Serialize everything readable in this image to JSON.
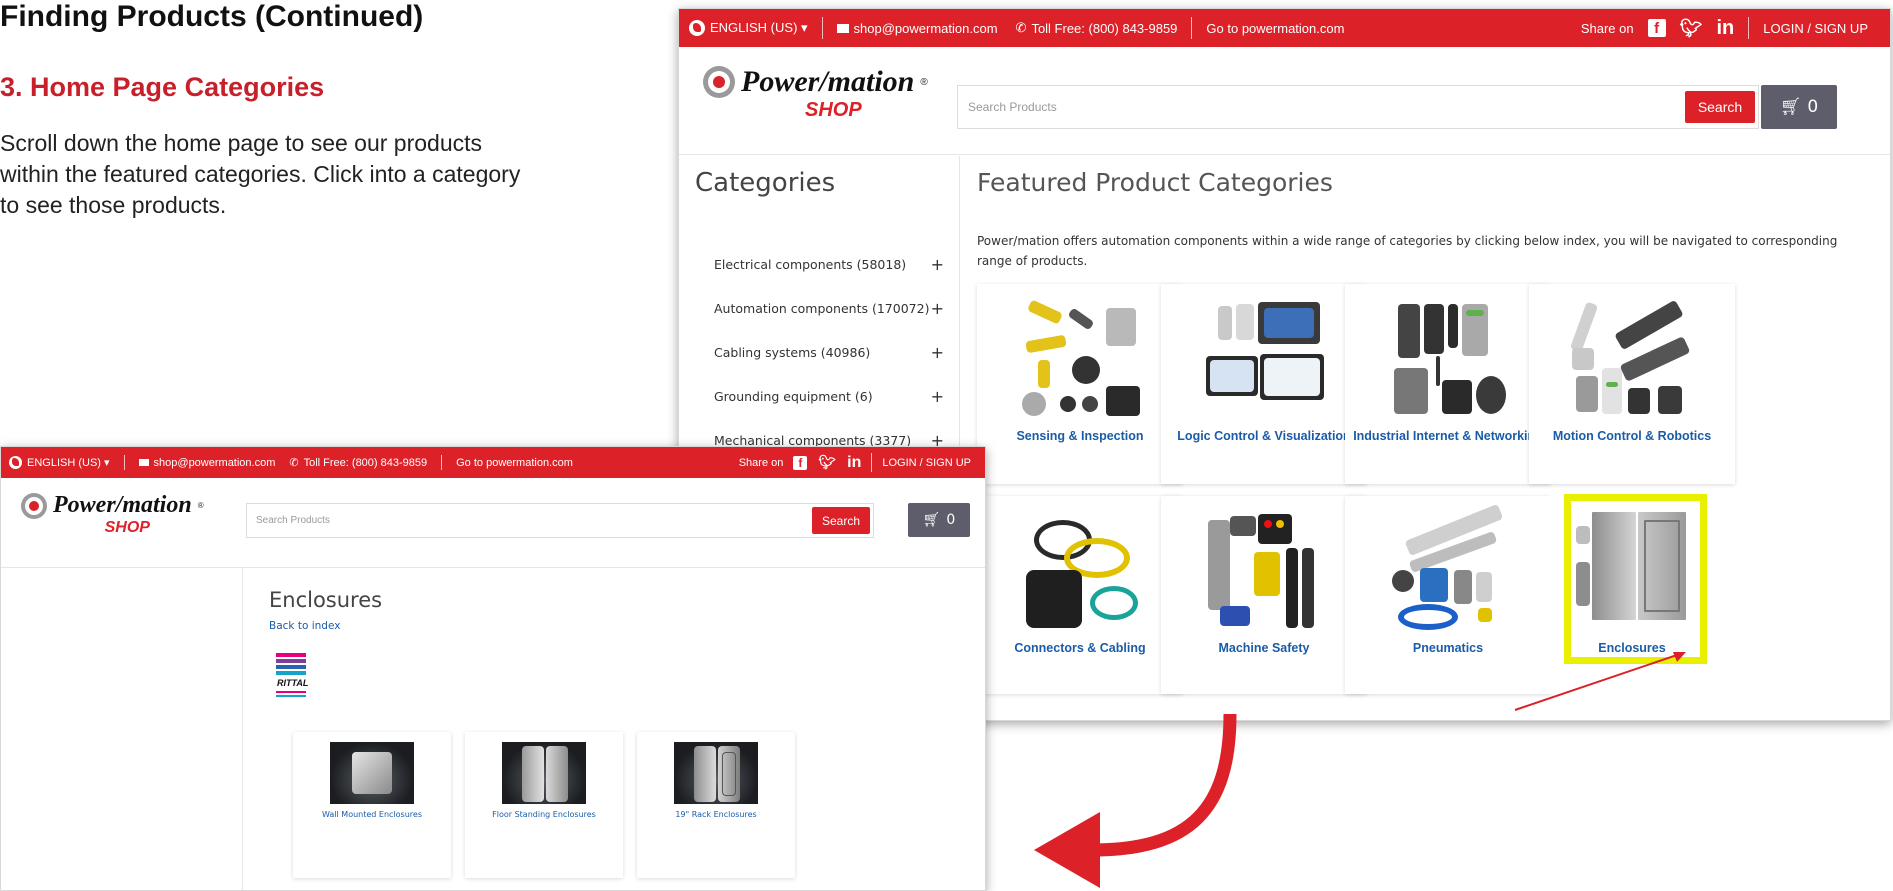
{
  "doc": {
    "heading": "Finding Products (Continued)",
    "subheading": "3.  Home Page Categories",
    "body_lines": [
      "Scroll down the home page to see our products",
      "within the featured categories. Click into a category",
      "to see those products."
    ]
  },
  "topbar": {
    "language": "ENGLISH (US) ▾",
    "email": "shop@powermation.com",
    "toll_free": "Toll Free: (800) 843-9859",
    "goto": "Go to powermation.com",
    "share_on": "Share on",
    "login": "LOGIN / SIGN UP"
  },
  "logo": {
    "word": "Power/mation",
    "reg": "®",
    "shop": "SHOP"
  },
  "search": {
    "placeholder": "Search Products",
    "button": "Search"
  },
  "cart": {
    "icon": "cart-icon",
    "count": "0"
  },
  "sidebar": {
    "title": "Categories",
    "items": [
      {
        "label": "Electrical components (58018)",
        "expand": "+"
      },
      {
        "label": "Automation components (170072)",
        "expand": "+"
      },
      {
        "label": "Cabling systems (40986)",
        "expand": "+"
      },
      {
        "label": "Grounding equipment (6)",
        "expand": "+"
      },
      {
        "label": "Mechanical components (3377)",
        "expand": "+"
      }
    ]
  },
  "featured": {
    "title": "Featured Product Categories",
    "description": "Power/mation offers automation components within a wide range of categories by clicking below index, you will be navigated to corresponding range of products.",
    "categories": [
      {
        "label": "Sensing & Inspection"
      },
      {
        "label": "Logic Control & Visualization"
      },
      {
        "label": "Industrial Internet & Networking"
      },
      {
        "label": "Motion Control & Robotics"
      },
      {
        "label": "Connectors & Cabling"
      },
      {
        "label": "Machine Safety"
      },
      {
        "label": "Pneumatics"
      },
      {
        "label": "Enclosures"
      }
    ],
    "highlight_color": "#e8f000"
  },
  "detail": {
    "title": "Enclosures",
    "back": "Back to index",
    "brand": "RITTAL",
    "products": [
      {
        "label": "Wall Mounted Enclosures"
      },
      {
        "label": "Floor Standing Enclosures"
      },
      {
        "label": "19\" Rack Enclosures"
      }
    ]
  },
  "colors": {
    "brand_red": "#dd2128",
    "link_blue": "#1a5ca8",
    "cart_gray": "#5d5d6b"
  }
}
